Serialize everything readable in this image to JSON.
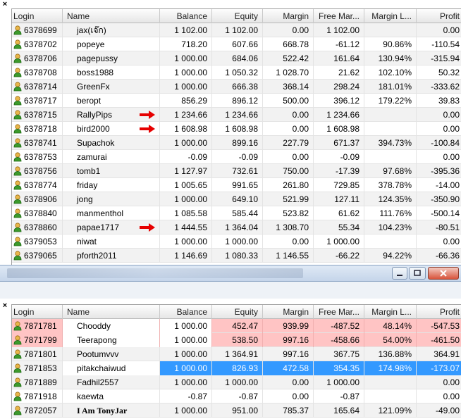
{
  "window": {
    "close_glyph": "×"
  },
  "columns": [
    "Login",
    "Name",
    "Balance",
    "Equity",
    "Margin",
    "Free Mar...",
    "Margin L...",
    "Profit"
  ],
  "top_rows": [
    {
      "login": "6378699",
      "name": "jax(เจ๊ก)",
      "balance": "1 102.00",
      "equity": "1 102.00",
      "margin": "0.00",
      "free": "1 102.00",
      "ml": "",
      "profit": "0.00"
    },
    {
      "login": "6378702",
      "name": "popeye",
      "balance": "718.20",
      "equity": "607.66",
      "margin": "668.78",
      "free": "-61.12",
      "ml": "90.86%",
      "profit": "-110.54"
    },
    {
      "login": "6378706",
      "name": "pagepussy",
      "balance": "1 000.00",
      "equity": "684.06",
      "margin": "522.42",
      "free": "161.64",
      "ml": "130.94%",
      "profit": "-315.94"
    },
    {
      "login": "6378708",
      "name": "boss1988",
      "balance": "1 000.00",
      "equity": "1 050.32",
      "margin": "1 028.70",
      "free": "21.62",
      "ml": "102.10%",
      "profit": "50.32"
    },
    {
      "login": "6378714",
      "name": "GreenFx",
      "balance": "1 000.00",
      "equity": "666.38",
      "margin": "368.14",
      "free": "298.24",
      "ml": "181.01%",
      "profit": "-333.62"
    },
    {
      "login": "6378717",
      "name": "beropt",
      "balance": "856.29",
      "equity": "896.12",
      "margin": "500.00",
      "free": "396.12",
      "ml": "179.22%",
      "profit": "39.83"
    },
    {
      "login": "6378715",
      "name": "RallyPips",
      "arrow": true,
      "balance": "1 234.66",
      "equity": "1 234.66",
      "margin": "0.00",
      "free": "1 234.66",
      "ml": "",
      "profit": "0.00"
    },
    {
      "login": "6378718",
      "name": "bird2000",
      "arrow": true,
      "balance": "1 608.98",
      "equity": "1 608.98",
      "margin": "0.00",
      "free": "1 608.98",
      "ml": "",
      "profit": "0.00"
    },
    {
      "login": "6378741",
      "name": "Supachok",
      "balance": "1 000.00",
      "equity": "899.16",
      "margin": "227.79",
      "free": "671.37",
      "ml": "394.73%",
      "profit": "-100.84"
    },
    {
      "login": "6378753",
      "name": "zamurai",
      "balance": "-0.09",
      "equity": "-0.09",
      "margin": "0.00",
      "free": "-0.09",
      "ml": "",
      "profit": "0.00"
    },
    {
      "login": "6378756",
      "name": "tomb1",
      "balance": "1 127.97",
      "equity": "732.61",
      "margin": "750.00",
      "free": "-17.39",
      "ml": "97.68%",
      "profit": "-395.36"
    },
    {
      "login": "6378774",
      "name": "friday",
      "balance": "1 005.65",
      "equity": "991.65",
      "margin": "261.80",
      "free": "729.85",
      "ml": "378.78%",
      "profit": "-14.00"
    },
    {
      "login": "6378906",
      "name": "jong",
      "balance": "1 000.00",
      "equity": "649.10",
      "margin": "521.99",
      "free": "127.11",
      "ml": "124.35%",
      "profit": "-350.90"
    },
    {
      "login": "6378840",
      "name": "manmenthol",
      "balance": "1 085.58",
      "equity": "585.44",
      "margin": "523.82",
      "free": "61.62",
      "ml": "111.76%",
      "profit": "-500.14"
    },
    {
      "login": "6378860",
      "name": "papae1717",
      "arrow": true,
      "balance": "1 444.55",
      "equity": "1 364.04",
      "margin": "1 308.70",
      "free": "55.34",
      "ml": "104.23%",
      "profit": "-80.51"
    },
    {
      "login": "6379053",
      "name": "niwat",
      "balance": "1 000.00",
      "equity": "1 000.00",
      "margin": "0.00",
      "free": "1 000.00",
      "ml": "",
      "profit": "0.00"
    },
    {
      "login": "6379065",
      "name": "pforth2011",
      "balance": "1 146.69",
      "equity": "1 080.33",
      "margin": "1 146.55",
      "free": "-66.22",
      "ml": "94.22%",
      "profit": "-66.36"
    }
  ],
  "bottom_rows": [
    {
      "login": "7871781",
      "name": "Chooddy",
      "style": "pink",
      "balance": "1 000.00",
      "equity": "452.47",
      "margin": "939.99",
      "free": "-487.52",
      "ml": "48.14%",
      "profit": "-547.53"
    },
    {
      "login": "7871799",
      "name": "Teerapong",
      "style": "pink",
      "balance": "1 000.00",
      "equity": "538.50",
      "margin": "997.16",
      "free": "-458.66",
      "ml": "54.00%",
      "profit": "-461.50"
    },
    {
      "login": "7871801",
      "name": "Pootumvvv",
      "balance": "1 000.00",
      "equity": "1 364.91",
      "margin": "997.16",
      "free": "367.75",
      "ml": "136.88%",
      "profit": "364.91"
    },
    {
      "login": "7871853",
      "name": "pitakchaiwud",
      "style": "sel",
      "balance": "1 000.00",
      "equity": "826.93",
      "margin": "472.58",
      "free": "354.35",
      "ml": "174.98%",
      "profit": "-173.07"
    },
    {
      "login": "7871889",
      "name": "Fadhil2557",
      "balance": "1 000.00",
      "equity": "1 000.00",
      "margin": "0.00",
      "free": "1 000.00",
      "ml": "",
      "profit": "0.00"
    },
    {
      "login": "7871918",
      "name": "kaewta",
      "balance": "-0.87",
      "equity": "-0.87",
      "margin": "0.00",
      "free": "-0.87",
      "ml": "",
      "profit": "0.00"
    },
    {
      "login": "7872057",
      "name": "I Am TonyJar",
      "serif": true,
      "balance": "1 000.00",
      "equity": "951.00",
      "margin": "785.37",
      "free": "165.64",
      "ml": "121.09%",
      "profit": "-49.00"
    }
  ],
  "colors": {
    "selection": "#3399ff",
    "alert_row": "#ffc4c4",
    "arrow": "#e60000"
  },
  "icons": {
    "user": "user-icon",
    "arrow": "red-arrow-icon"
  }
}
